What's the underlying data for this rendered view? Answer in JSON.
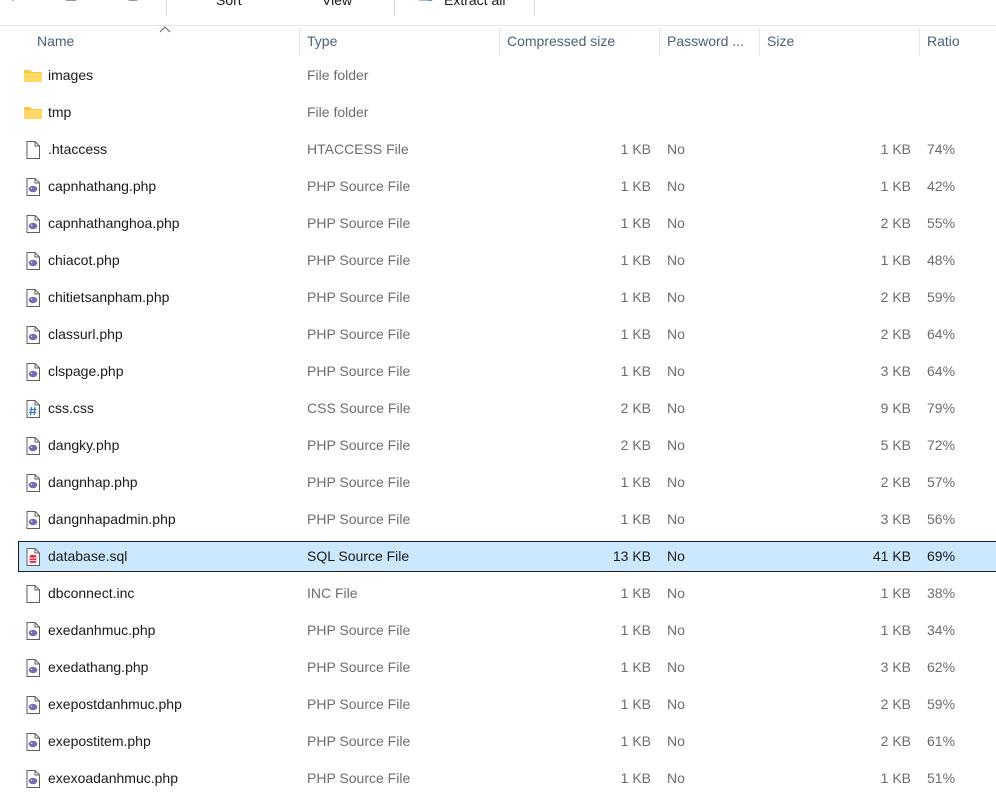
{
  "toolbar": {
    "sort_label": "Sort",
    "view_label": "View",
    "extract_label": "Extract all"
  },
  "columns": {
    "name": "Name",
    "type": "Type",
    "compressed": "Compressed size",
    "password": "Password ...",
    "size": "Size",
    "ratio": "Ratio"
  },
  "colors": {
    "selected_bg": "#cce8ff",
    "folder": "#f8c845",
    "php_badge": "#7a6bb0",
    "sql_badge": "#d9304c",
    "css_badge": "#3b7dc4"
  },
  "files": [
    {
      "name": "images",
      "type": "File folder",
      "compressed": "",
      "password": "",
      "size": "",
      "ratio": "",
      "icon": "folder-icon"
    },
    {
      "name": "tmp",
      "type": "File folder",
      "compressed": "",
      "password": "",
      "size": "",
      "ratio": "",
      "icon": "folder-icon"
    },
    {
      "name": ".htaccess",
      "type": "HTACCESS File",
      "compressed": "1 KB",
      "password": "No",
      "size": "1 KB",
      "ratio": "74%",
      "icon": "blank-file-icon"
    },
    {
      "name": "capnhathang.php",
      "type": "PHP Source File",
      "compressed": "1 KB",
      "password": "No",
      "size": "1 KB",
      "ratio": "42%",
      "icon": "php-file-icon"
    },
    {
      "name": "capnhathanghoa.php",
      "type": "PHP Source File",
      "compressed": "1 KB",
      "password": "No",
      "size": "2 KB",
      "ratio": "55%",
      "icon": "php-file-icon"
    },
    {
      "name": "chiacot.php",
      "type": "PHP Source File",
      "compressed": "1 KB",
      "password": "No",
      "size": "1 KB",
      "ratio": "48%",
      "icon": "php-file-icon"
    },
    {
      "name": "chitietsanpham.php",
      "type": "PHP Source File",
      "compressed": "1 KB",
      "password": "No",
      "size": "2 KB",
      "ratio": "59%",
      "icon": "php-file-icon"
    },
    {
      "name": "classurl.php",
      "type": "PHP Source File",
      "compressed": "1 KB",
      "password": "No",
      "size": "2 KB",
      "ratio": "64%",
      "icon": "php-file-icon"
    },
    {
      "name": "clspage.php",
      "type": "PHP Source File",
      "compressed": "1 KB",
      "password": "No",
      "size": "3 KB",
      "ratio": "64%",
      "icon": "php-file-icon"
    },
    {
      "name": "css.css",
      "type": "CSS Source File",
      "compressed": "2 KB",
      "password": "No",
      "size": "9 KB",
      "ratio": "79%",
      "icon": "css-file-icon"
    },
    {
      "name": "dangky.php",
      "type": "PHP Source File",
      "compressed": "2 KB",
      "password": "No",
      "size": "5 KB",
      "ratio": "72%",
      "icon": "php-file-icon"
    },
    {
      "name": "dangnhap.php",
      "type": "PHP Source File",
      "compressed": "1 KB",
      "password": "No",
      "size": "2 KB",
      "ratio": "57%",
      "icon": "php-file-icon"
    },
    {
      "name": "dangnhapadmin.php",
      "type": "PHP Source File",
      "compressed": "1 KB",
      "password": "No",
      "size": "3 KB",
      "ratio": "56%",
      "icon": "php-file-icon"
    },
    {
      "name": "database.sql",
      "type": "SQL Source File",
      "compressed": "13 KB",
      "password": "No",
      "size": "41 KB",
      "ratio": "69%",
      "icon": "sql-file-icon",
      "selected": true
    },
    {
      "name": "dbconnect.inc",
      "type": "INC File",
      "compressed": "1 KB",
      "password": "No",
      "size": "1 KB",
      "ratio": "38%",
      "icon": "blank-file-icon"
    },
    {
      "name": "exedanhmuc.php",
      "type": "PHP Source File",
      "compressed": "1 KB",
      "password": "No",
      "size": "1 KB",
      "ratio": "34%",
      "icon": "php-file-icon"
    },
    {
      "name": "exedathang.php",
      "type": "PHP Source File",
      "compressed": "1 KB",
      "password": "No",
      "size": "3 KB",
      "ratio": "62%",
      "icon": "php-file-icon"
    },
    {
      "name": "exepostdanhmuc.php",
      "type": "PHP Source File",
      "compressed": "1 KB",
      "password": "No",
      "size": "2 KB",
      "ratio": "59%",
      "icon": "php-file-icon"
    },
    {
      "name": "exepostitem.php",
      "type": "PHP Source File",
      "compressed": "1 KB",
      "password": "No",
      "size": "2 KB",
      "ratio": "61%",
      "icon": "php-file-icon"
    },
    {
      "name": "exexoadanhmuc.php",
      "type": "PHP Source File",
      "compressed": "1 KB",
      "password": "No",
      "size": "1 KB",
      "ratio": "51%",
      "icon": "php-file-icon"
    }
  ]
}
